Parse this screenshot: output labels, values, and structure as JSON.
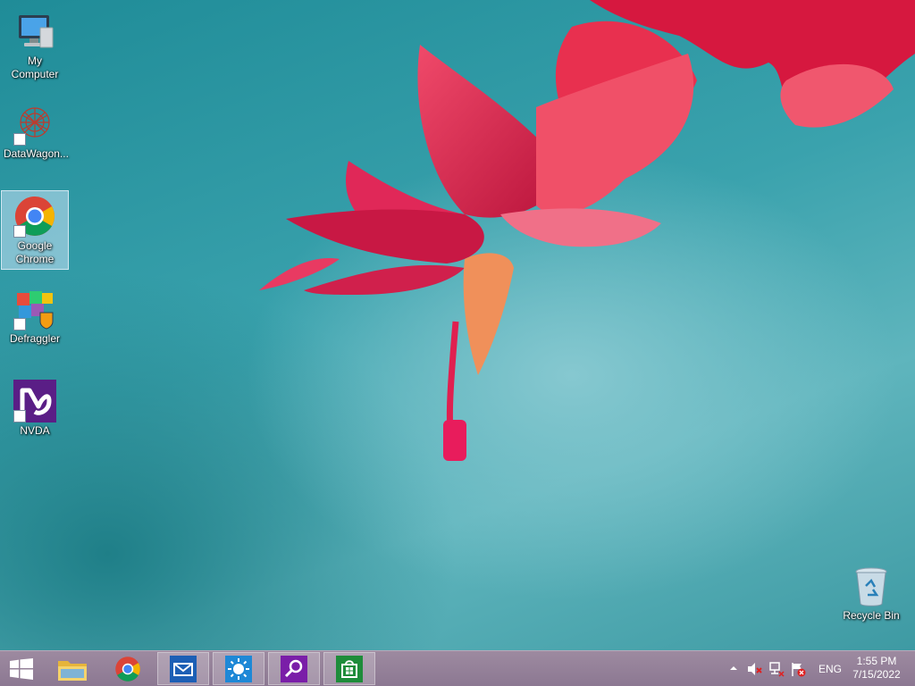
{
  "desktop": {
    "icons": [
      {
        "label": "My Computer",
        "icon": "my-computer-icon"
      },
      {
        "label": "DataWagon...",
        "icon": "datawagon-icon"
      },
      {
        "label": "Google Chrome",
        "icon": "chrome-icon",
        "selected": true
      },
      {
        "label": "Defraggler",
        "icon": "defraggler-icon"
      },
      {
        "label": "NVDA",
        "icon": "nvda-icon"
      },
      {
        "label": "Recycle Bin",
        "icon": "recycle-bin-icon"
      }
    ]
  },
  "taskbar": {
    "pinned": [
      {
        "name": "start",
        "icon": "windows-start-icon"
      },
      {
        "name": "file-explorer",
        "icon": "folder-icon"
      },
      {
        "name": "chrome",
        "icon": "chrome-icon"
      },
      {
        "name": "mail",
        "icon": "mail-icon"
      },
      {
        "name": "weather",
        "icon": "sun-icon"
      },
      {
        "name": "search",
        "icon": "search-icon"
      },
      {
        "name": "store",
        "icon": "store-icon"
      }
    ],
    "tray": {
      "language": "ENG",
      "time": "1:55 PM",
      "date": "7/15/2022"
    }
  },
  "colors": {
    "taskbar": "#8c7892",
    "wallpaper_teal": "#2e97a2",
    "flower": "#e8234f",
    "mail_tile": "#1c5fb5",
    "weather_tile": "#1e88d6",
    "search_tile": "#7a1ea8",
    "store_tile": "#1e8c3a"
  }
}
